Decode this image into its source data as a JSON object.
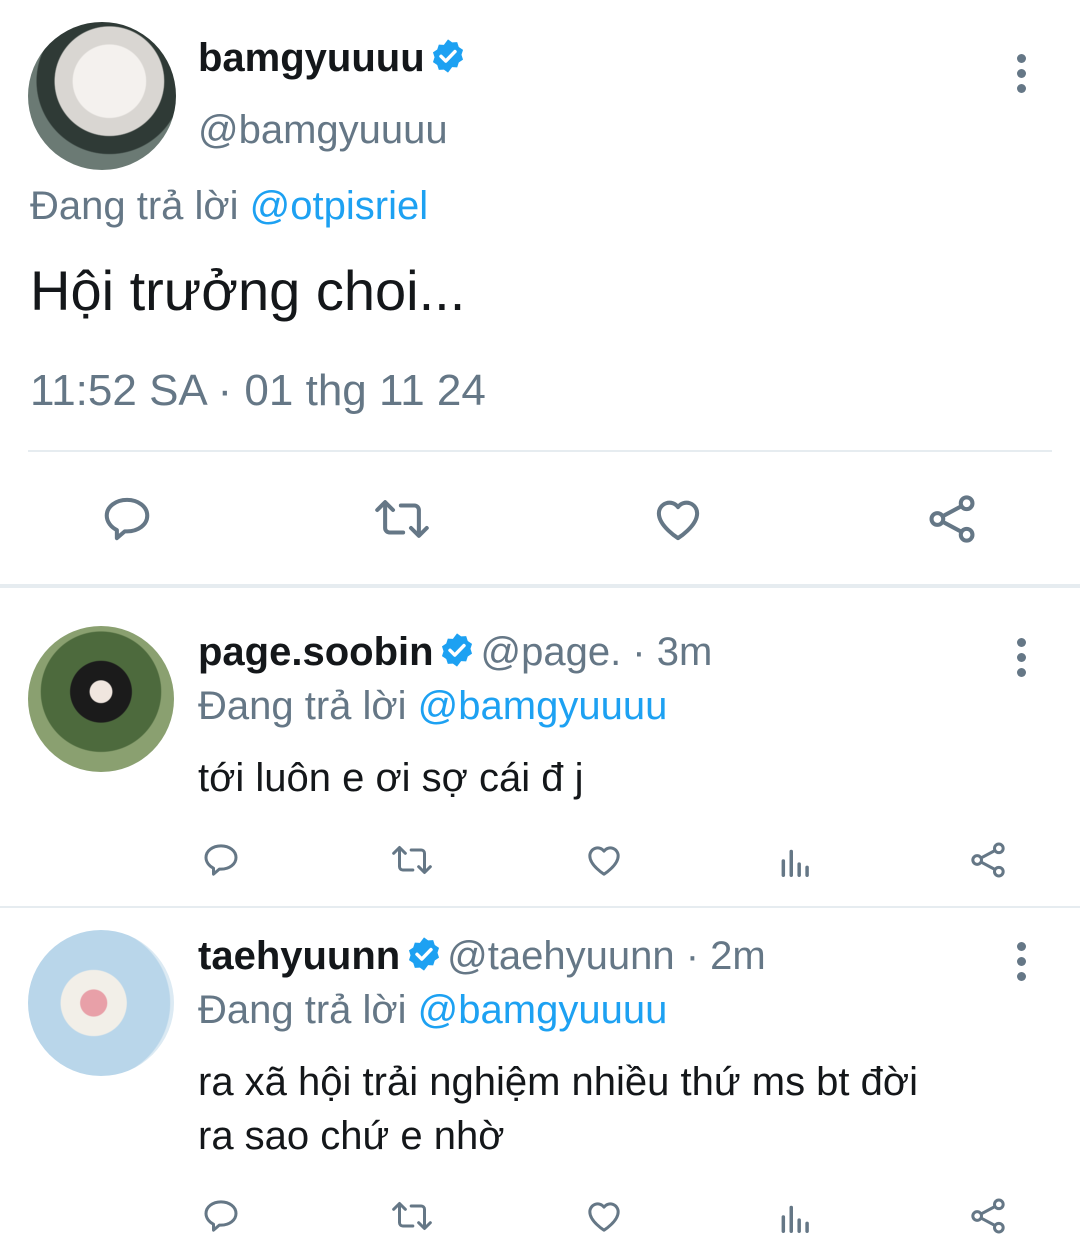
{
  "main_tweet": {
    "display_name": "bamgyuuuu",
    "handle": "@bamgyuuuu",
    "replying_prefix": "Đang trả lời",
    "replying_to": "@otpisriel",
    "text": "Hội trưởng choi...",
    "timestamp": "11:52 SA · 01 thg 11 24"
  },
  "replies": [
    {
      "display_name": "page.soobin",
      "handle_time": "@page. · 3m",
      "replying_prefix": "Đang trả lời",
      "replying_to": "@bamgyuuuu",
      "text": "tới luôn e ơi sợ cái đ j"
    },
    {
      "display_name": "taehyuunn",
      "handle_time": "@taehyuunn · 2m",
      "replying_prefix": "Đang trả lời",
      "replying_to": "@bamgyuuuu",
      "text_line1": "ra xã hội trải nghiệm nhiều thứ ms bt đời",
      "text_line2": "ra sao chứ e nhờ"
    }
  ],
  "colors": {
    "accent": "#1da1f2",
    "secondary_text": "#657786",
    "icon": "#657786",
    "divider": "#e6ecf0"
  },
  "icons": [
    "verified-badge-icon",
    "more-options-icon",
    "reply-icon",
    "retweet-icon",
    "like-icon",
    "analytics-icon",
    "share-icon"
  ]
}
